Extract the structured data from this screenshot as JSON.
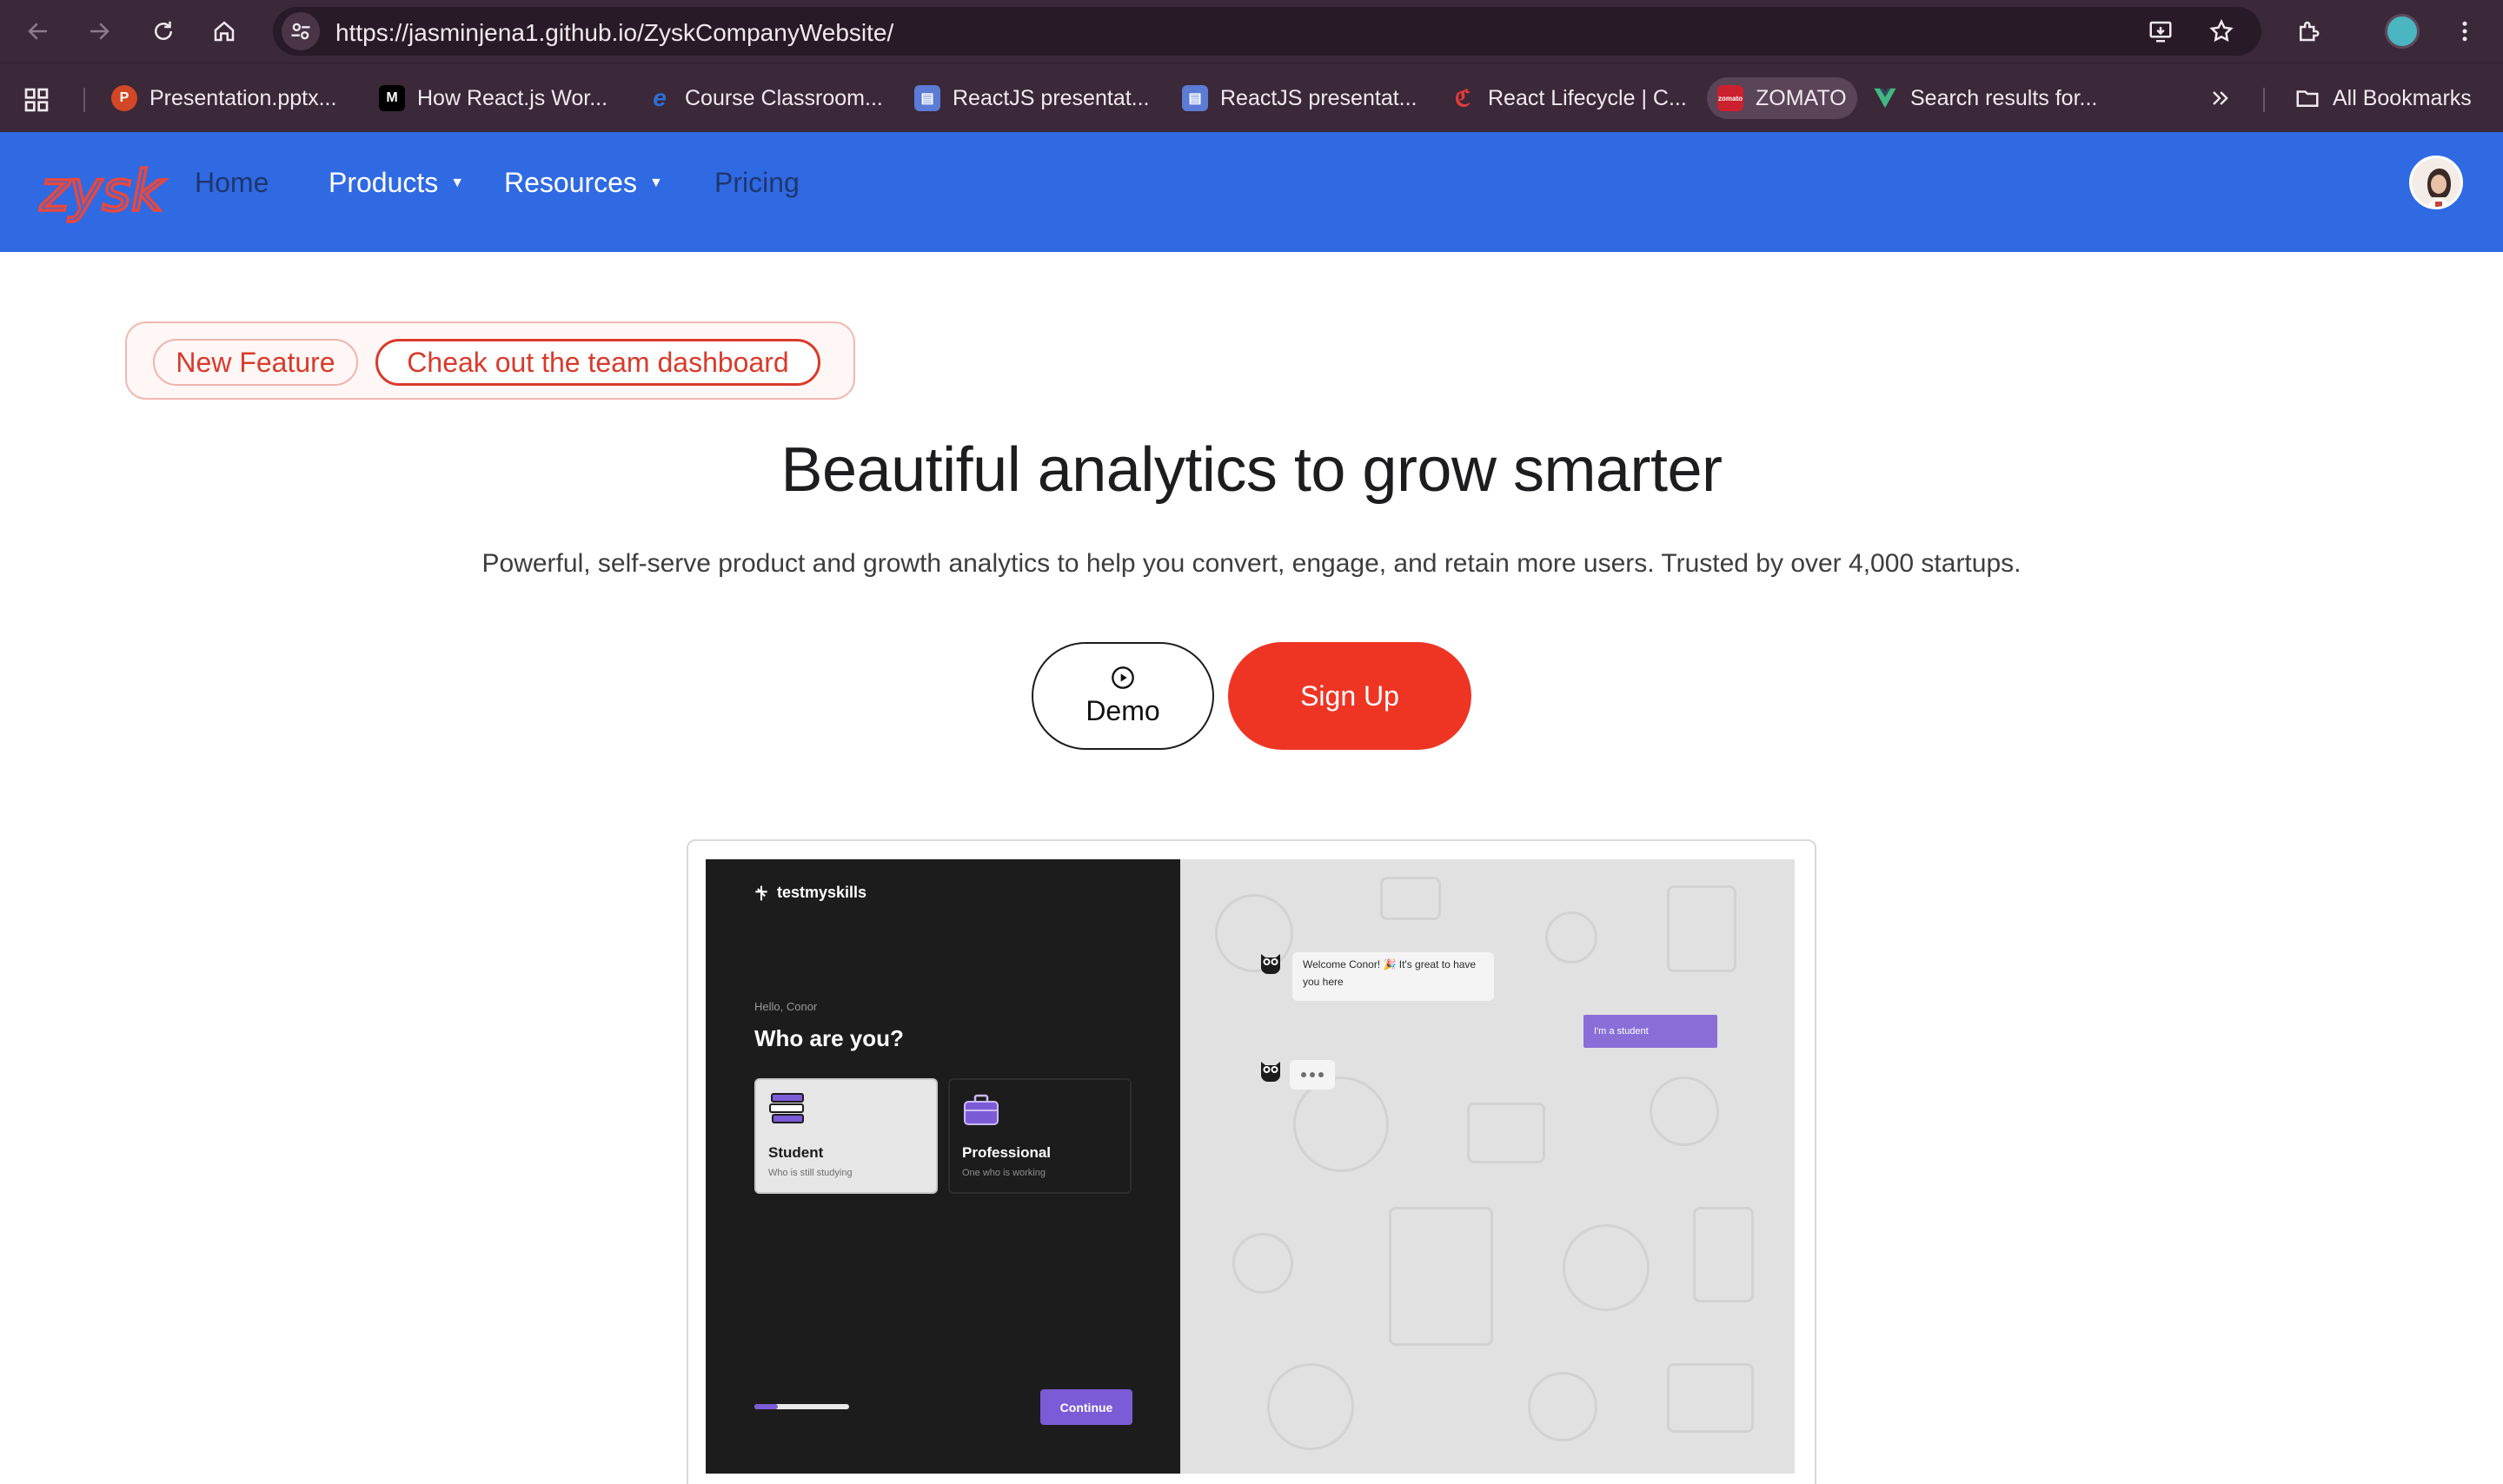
{
  "browser": {
    "url": "https://jasminjena1.github.io/ZyskCompanyWebsite/",
    "bookmarks": [
      {
        "label": "Presentation.pptx...",
        "icon": "powerpoint-icon",
        "color": "#d24726"
      },
      {
        "label": "How React.js Wor...",
        "icon": "medium-icon",
        "color": "#000000"
      },
      {
        "label": "Course Classroom...",
        "icon": "edureka-icon",
        "color": "#2d6fd9"
      },
      {
        "label": "ReactJS presentat...",
        "icon": "slides-icon",
        "color": "#5b7bd5"
      },
      {
        "label": "ReactJS presentat...",
        "icon": "slides-icon",
        "color": "#5b7bd5"
      },
      {
        "label": "React Lifecycle | C...",
        "icon": "codecademy-icon",
        "color": "#e33b3b"
      },
      {
        "label": "ZOMATO",
        "icon": "zomato-icon",
        "color": "#cb202d"
      },
      {
        "label": "Search results for...",
        "icon": "vue-icon",
        "color": "#41b883"
      }
    ],
    "all_bookmarks_label": "All Bookmarks"
  },
  "site": {
    "logo_text": "zysk",
    "nav": {
      "home": "Home",
      "products": "Products",
      "resources": "Resources",
      "pricing": "Pricing"
    },
    "colors": {
      "nav_bg": "#2f6ae3",
      "accent_red": "#ee3524",
      "badge_red": "#d93a2b",
      "purple": "#7b5cd6"
    }
  },
  "hero": {
    "badge_new": "New Feature",
    "badge_cta": "Cheak out the team dashboard",
    "title": "Beautiful analytics to grow smarter",
    "subtitle": "Powerful, self-serve product and growth analytics to help you convert, engage, and retain more users. Trusted by over 4,000 startups.",
    "demo_label": "Demo",
    "signup_label": "Sign Up"
  },
  "preview": {
    "brand": "testmyskills",
    "hello": "Hello, Conor",
    "question": "Who are you?",
    "options": [
      {
        "title": "Student",
        "subtitle": "Who is still studying"
      },
      {
        "title": "Professional",
        "subtitle": "One who is working"
      }
    ],
    "progress": 0.25,
    "continue_label": "Continue",
    "bot_message_line1": "Welcome Conor! 🎉 It's great to have",
    "bot_message_line2": "you here",
    "user_reply": "I'm a student"
  }
}
